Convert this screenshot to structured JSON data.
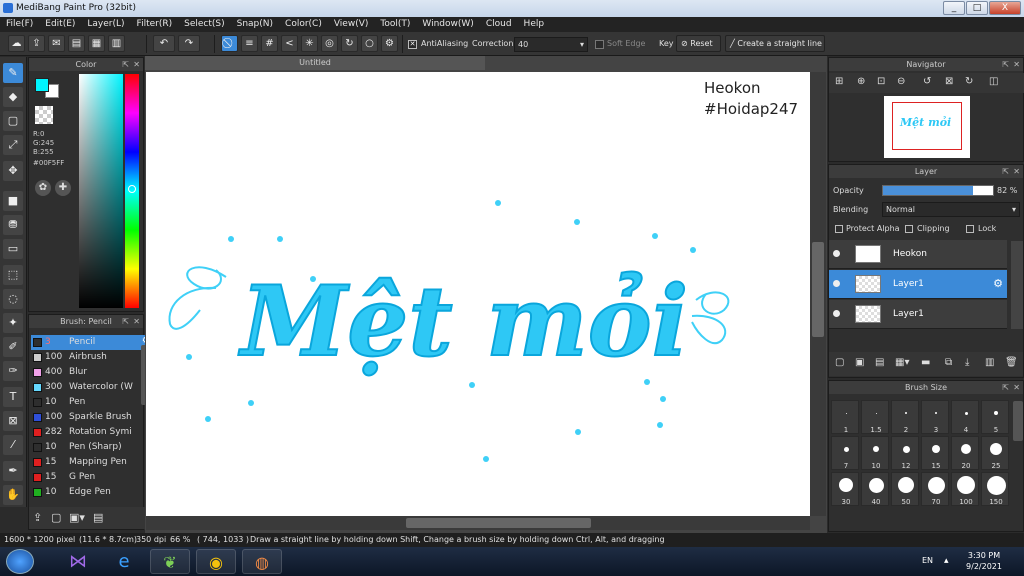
{
  "window": {
    "title": "MediBang Paint Pro (32bit)",
    "minimize": "_",
    "maximize": "□",
    "close": "X"
  },
  "menu": [
    "File(F)",
    "Edit(E)",
    "Layer(L)",
    "Filter(R)",
    "Select(S)",
    "Snap(N)",
    "Color(C)",
    "View(V)",
    "Tool(T)",
    "Window(W)",
    "Cloud",
    "Help"
  ],
  "toolbar": {
    "antialiasing_label": "AntiAliasing",
    "correction_label": "Correction",
    "correction_value": "40",
    "soft_edge_label": "Soft Edge",
    "key_label": "Key",
    "reset_label": "Reset",
    "straight_line_label": "Create a straight line"
  },
  "color_panel": {
    "title": "Color",
    "r": "R:0",
    "g": "G:245",
    "b": "B:255",
    "hex": "#00F5FF",
    "fg": "#00F5FF",
    "bg": "#ffffff"
  },
  "brush_panel": {
    "title": "Brush: Pencil",
    "items": [
      {
        "size": "3",
        "name": "Pencil",
        "color": "#2e2e2e"
      },
      {
        "size": "100",
        "name": "Airbrush",
        "color": "#cccccc"
      },
      {
        "size": "400",
        "name": "Blur",
        "color": "#f0a0e8"
      },
      {
        "size": "300",
        "name": "Watercolor (W",
        "color": "#66d9ff"
      },
      {
        "size": "10",
        "name": "Pen",
        "color": "#2e2e2e"
      },
      {
        "size": "100",
        "name": "Sparkle Brush",
        "color": "#2f4fd8"
      },
      {
        "size": "282",
        "name": "Rotation Symi",
        "color": "#e02020"
      },
      {
        "size": "10",
        "name": "Pen (Sharp)",
        "color": "#2e2e2e"
      },
      {
        "size": "15",
        "name": "Mapping Pen",
        "color": "#e02020"
      },
      {
        "size": "15",
        "name": "G Pen",
        "color": "#e02020"
      },
      {
        "size": "10",
        "name": "Edge Pen",
        "color": "#20b020"
      }
    ]
  },
  "canvas": {
    "tab": "Untitled",
    "watermark_line1": "Heokon",
    "watermark_line2": "#Hoidap247",
    "artwork_text": "Mệt mỏi",
    "artwork_color": "#2ec8f5"
  },
  "navigator": {
    "title": "Navigator",
    "preview_text": "Mệt mỏi"
  },
  "layer_panel": {
    "title": "Layer",
    "opacity_label": "Opacity",
    "opacity_value": "82 %",
    "opacity": 0.82,
    "blending_label": "Blending",
    "blending_value": "Normal",
    "protect_alpha": "Protect Alpha",
    "clipping": "Clipping",
    "lock": "Lock",
    "layers": [
      {
        "name": "Heokon",
        "selected": false
      },
      {
        "name": "Layer1",
        "selected": true
      },
      {
        "name": "Layer1",
        "selected": false
      }
    ]
  },
  "brush_size_panel": {
    "title": "Brush Size",
    "row1": [
      "1",
      "1.5",
      "2",
      "3",
      "4",
      "5"
    ],
    "row2": [
      "7",
      "10",
      "12",
      "15",
      "20",
      "25"
    ],
    "row3": [
      "30",
      "40",
      "50",
      "70",
      "100",
      "150"
    ]
  },
  "status": {
    "dimensions": "1600 * 1200 pixel",
    "cm": "(11.6 * 8.7cm)",
    "dpi": "350 dpi",
    "zoom": "66 %",
    "cursor": "( 744, 1033 )",
    "hint": "Draw a straight line by holding down Shift, Change a brush size by holding down Ctrl, Alt, and dragging"
  },
  "taskbar": {
    "lang": "EN",
    "time": "3:30 PM",
    "date": "9/2/2021"
  }
}
